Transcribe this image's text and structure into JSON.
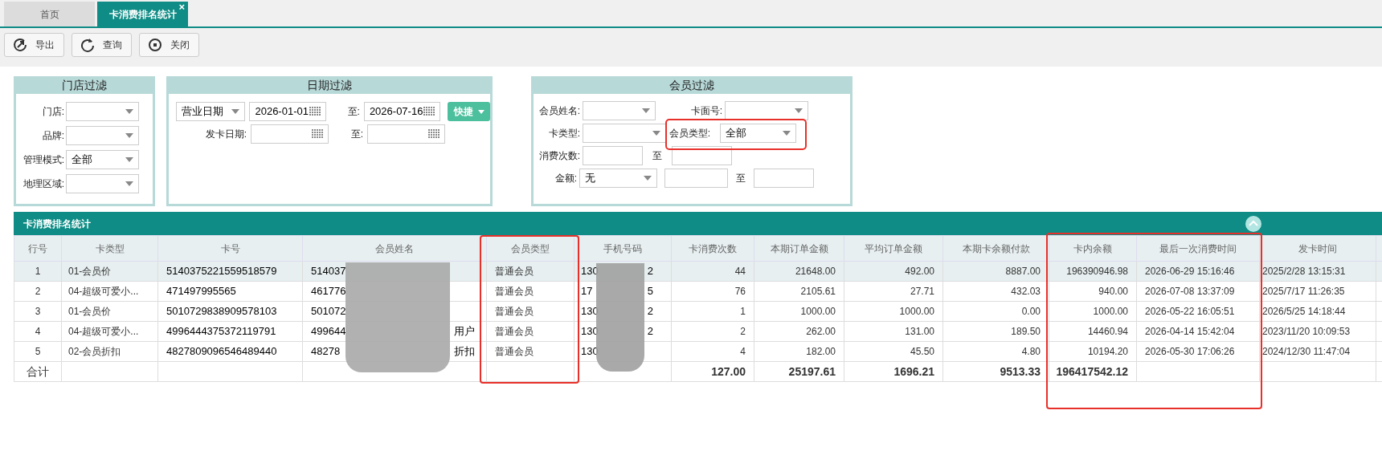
{
  "tabs": [
    {
      "label": "首页",
      "selected": false
    },
    {
      "label": "卡消费排名统计",
      "selected": true,
      "close": "×"
    }
  ],
  "toolbar": [
    {
      "kind": "export",
      "label": "导出"
    },
    {
      "kind": "refresh",
      "label": "查询"
    },
    {
      "kind": "close",
      "label": "关闭"
    }
  ],
  "store_filter": {
    "title": "门店过滤",
    "fields": [
      {
        "label": "门店:"
      },
      {
        "label": "品牌:"
      },
      {
        "label": "管理模式:",
        "value": "全部"
      },
      {
        "label": "地理区域:"
      }
    ]
  },
  "date_filter": {
    "title": "日期过滤",
    "date_type": "营业日期",
    "from": "2026-01-01",
    "to_label": "至:",
    "to": "2026-07-16",
    "quick": "快捷",
    "issue_label": "发卡日期:",
    "issue_to_label": "至:"
  },
  "member_filter": {
    "title": "会员过滤",
    "name_label": "会员姓名:",
    "card_face_label": "卡面号:",
    "card_type_label": "卡类型:",
    "member_type_label": "会员类型:",
    "member_type": "全部",
    "count_label": "消费次数:",
    "count_to": "至",
    "amount_label": "金额:",
    "amount_op": "无",
    "amount_to": "至"
  },
  "table": {
    "title": "卡消费排名统计",
    "columns": [
      "行号",
      "卡类型",
      "卡号",
      "会员姓名",
      "会员类型",
      "手机号码",
      "卡消费次数",
      "本期订单金额",
      "平均订单金额",
      "本期卡余额付款",
      "卡内余额",
      "最后一次消费时间",
      "发卡时间"
    ],
    "rows": [
      {
        "no": "1",
        "card_type": "01-会员价",
        "card_no": "5140375221559518579",
        "name_start": "514037",
        "member_type": "普通会员",
        "phone_start": "130",
        "phone_end": "2",
        "count": "44",
        "order_total": "21648.00",
        "order_avg": "492.00",
        "balance_paid": "8887.00",
        "balance": "196390946.98",
        "last_time": "2026-06-29 15:16:46",
        "issue_time": "2025/2/28 13:15:31",
        "selected": true
      },
      {
        "no": "2",
        "card_type": "04-超级可爱小...",
        "card_no": "471497995565",
        "name_start": "461776",
        "member_type": "普通会员",
        "phone_start": "17",
        "phone_end": "5",
        "count": "76",
        "order_total": "2105.61",
        "order_avg": "27.71",
        "balance_paid": "432.03",
        "balance": "940.00",
        "last_time": "2026-07-08 13:37:09",
        "issue_time": "2025/7/17 11:26:35",
        "selected": false
      },
      {
        "no": "3",
        "card_type": "01-会员价",
        "card_no": "5010729838909578103",
        "name_start": "501072",
        "member_type": "普通会员",
        "phone_start": "130",
        "phone_end": "2",
        "count": "1",
        "order_total": "1000.00",
        "order_avg": "1000.00",
        "balance_paid": "0.00",
        "balance": "1000.00",
        "last_time": "2026-05-22 16:05:51",
        "issue_time": "2026/5/25 14:18:44",
        "selected": false
      },
      {
        "no": "4",
        "card_type": "04-超级可爱小...",
        "card_no": "4996444375372119791",
        "name_start": "499644",
        "name_end": "用户",
        "member_type": "普通会员",
        "phone_start": "130",
        "phone_end": "2",
        "count": "2",
        "order_total": "262.00",
        "order_avg": "131.00",
        "balance_paid": "189.50",
        "balance": "14460.94",
        "last_time": "2026-04-14 15:42:04",
        "issue_time": "2023/11/20 10:09:53",
        "selected": false
      },
      {
        "no": "5",
        "card_type": "02-会员折扣",
        "card_no": "4827809096546489440",
        "name_start": "48278",
        "name_end": "折扣",
        "member_type": "普通会员",
        "phone_start": "130",
        "count": "4",
        "order_total": "182.00",
        "order_avg": "45.50",
        "balance_paid": "4.80",
        "balance": "10194.20",
        "last_time": "2026-05-30 17:06:26",
        "issue_time": "2024/12/30 11:47:04",
        "selected": false
      }
    ],
    "totals": {
      "label": "合计",
      "count": "127.00",
      "order_total": "25197.61",
      "order_avg": "1696.21",
      "balance_paid": "9513.33",
      "balance": "196417542.12"
    }
  }
}
